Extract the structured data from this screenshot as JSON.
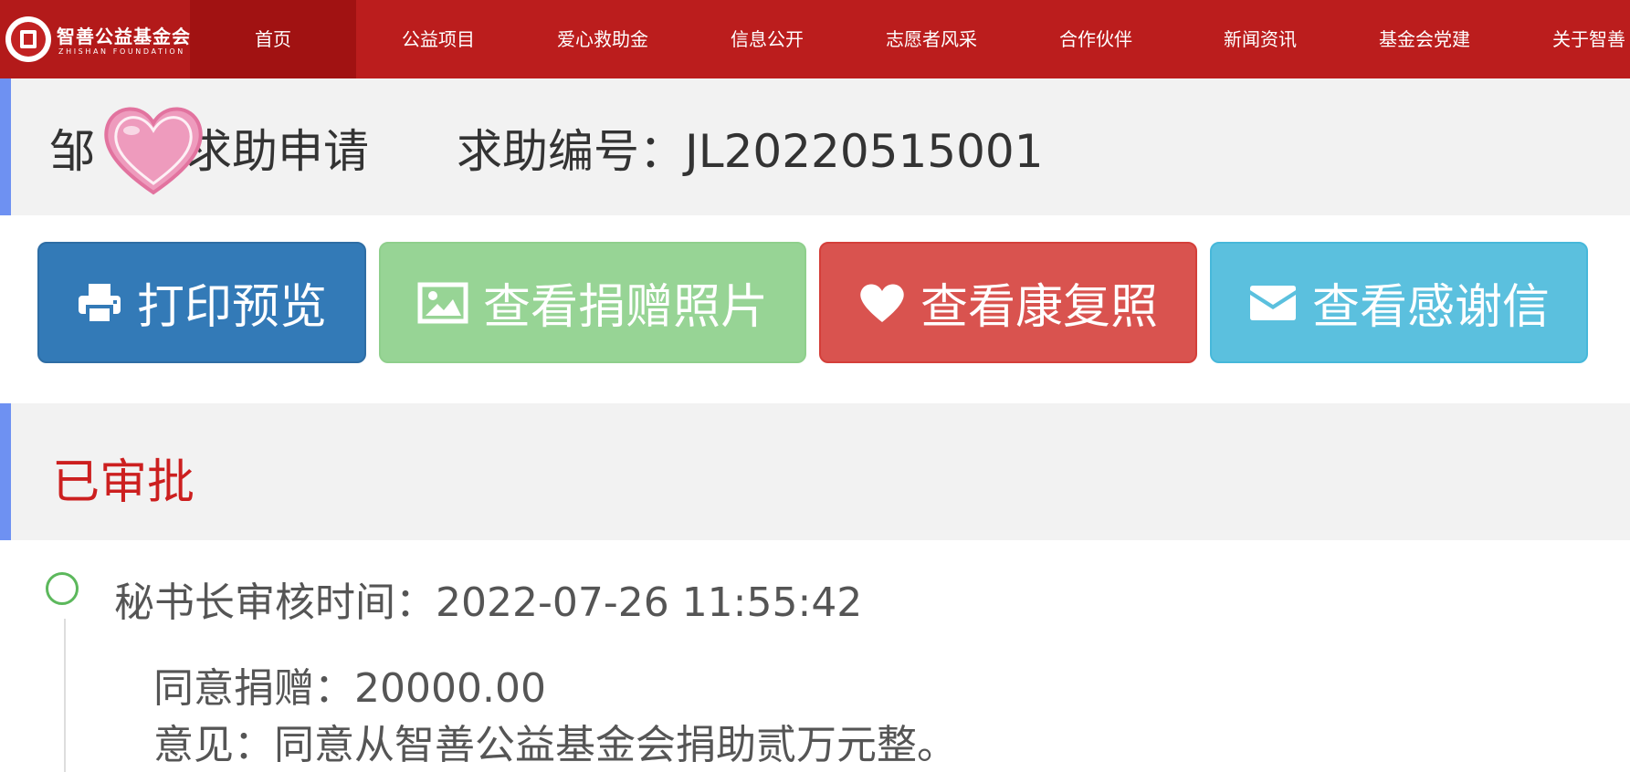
{
  "nav": {
    "logo_name": "智善公益基金会",
    "logo_sub": "ZHISHAN FOUNDATION",
    "items": [
      {
        "label": "首页"
      },
      {
        "label": "公益项目"
      },
      {
        "label": "爱心救助金"
      },
      {
        "label": "信息公开"
      },
      {
        "label": "志愿者风采"
      },
      {
        "label": "合作伙伴"
      },
      {
        "label": "新闻资讯"
      },
      {
        "label": "基金会党建"
      },
      {
        "label": "关于智善"
      }
    ],
    "active_index": 0
  },
  "header": {
    "applicant_title": "邹　的求助申请",
    "code_text": "求助编号：JL20220515001"
  },
  "actions": {
    "print": "打印预览",
    "photos": "查看捐赠照片",
    "recovery": "查看康复照",
    "letter": "查看感谢信"
  },
  "status": {
    "label": "已审批"
  },
  "timeline": {
    "time_text": "秘书长审核时间：2022-07-26 11:55:42",
    "amount_text": "同意捐赠：20000.00",
    "opinion_text": "意见：同意从智善公益基金会捐助贰万元整。"
  },
  "colors": {
    "nav_bg": "#bb1d1d",
    "nav_active": "#a11212",
    "accent_bar": "#6e91f2",
    "btn_print": "#337ab7",
    "btn_photos": "#97d495",
    "btn_recovery": "#d9534f",
    "btn_letter": "#5bc0de",
    "status_red": "#cc1f1f",
    "timeline_green": "#5cb85c"
  },
  "icons": {
    "print": "print-icon",
    "photos": "image-icon",
    "recovery": "heart-icon",
    "letter": "envelope-icon",
    "sticker": "heart-sticker-icon",
    "timeline": "circle-icon"
  }
}
